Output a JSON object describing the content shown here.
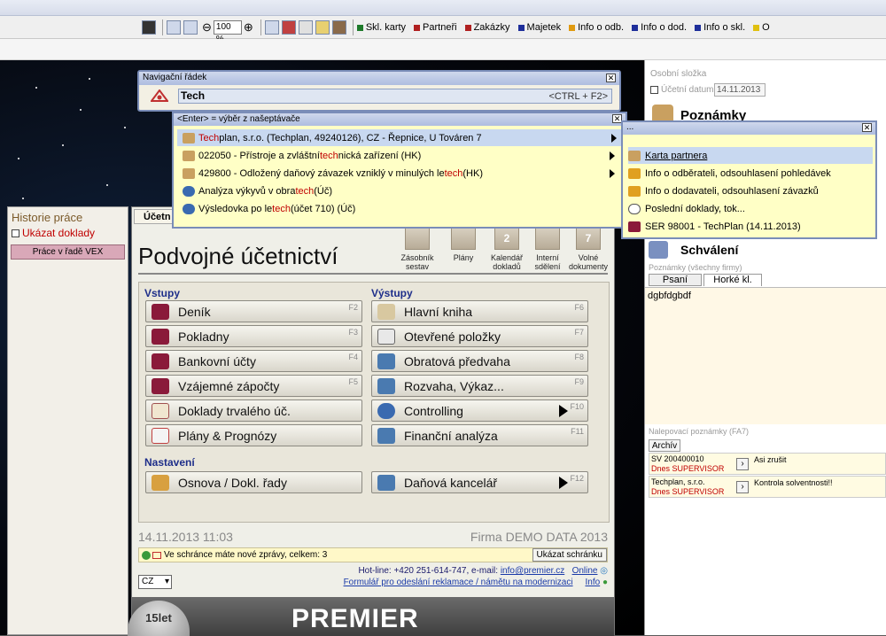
{
  "toolbar": {
    "zoom": "100 %",
    "legend": [
      {
        "label": "Skl. karty",
        "color": "#1e7a2a"
      },
      {
        "label": "Partneři",
        "color": "#b02020"
      },
      {
        "label": "Zakázky",
        "color": "#b02020"
      },
      {
        "label": "Majetek",
        "color": "#1e2e9a"
      },
      {
        "label": "Info o odb.",
        "color": "#e09a10"
      },
      {
        "label": "Info o dod.",
        "color": "#1e2e9a"
      },
      {
        "label": "Info o skl.",
        "color": "#1e2e9a"
      },
      {
        "label": "O",
        "color": "#e0c010"
      }
    ]
  },
  "nav": {
    "title": "Navigační řádek",
    "input_value": "Tech",
    "shortcut_hint": "<CTRL + F2>"
  },
  "suggest": {
    "header": "<Enter> = výběr z našeptávače",
    "rows": [
      {
        "pre": "",
        "hl": "Tech",
        "post": "plan, s.r.o. (Techplan, 49240126), CZ - Řepnice, U Továren 7",
        "arrow": true
      },
      {
        "pre": "022050 - Přístroje a zvláštní ",
        "hl": "tech",
        "post": "nická zařízení (HK)",
        "arrow": true
      },
      {
        "pre": "429800 - Odložený daňový závazek vzniklý v minulých le",
        "hl": "tech",
        "post": " (HK)",
        "arrow": true
      },
      {
        "pre": "Analýza výkyvů v obra",
        "hl": "tech",
        "post": " (Úč)",
        "arrow": false
      },
      {
        "pre": "Výsledovka po le",
        "hl": "tech",
        "post": " (účet 710) (Úč)",
        "arrow": false
      }
    ]
  },
  "ctx": {
    "header": "...",
    "items": [
      "Karta partnera",
      "Info o odběrateli, odsouhlasení pohledávek",
      "Info o dodavateli, odsouhlasení závazků",
      "Poslední doklady, tok...",
      "SER 98001 - TechPlan (14.11.2013)"
    ]
  },
  "history": {
    "title": "Historie práce",
    "show_docs": "Ukázat doklady",
    "button": "Práce v řadě VEX"
  },
  "main": {
    "tab": "Účetn",
    "title": "Podvojné účetnictví",
    "quick": [
      {
        "label": "Zásobník sestav"
      },
      {
        "label": "Plány"
      },
      {
        "label": "Kalendář dokladů",
        "badge": "2"
      },
      {
        "label": "Interní sdělení"
      },
      {
        "label": "Volné dokumenty",
        "badge": "7"
      }
    ],
    "inputs_header": "Vstupy",
    "outputs_header": "Výstupy",
    "settings_header": "Nastavení",
    "inputs": [
      {
        "label": "Deník",
        "key": "F2"
      },
      {
        "label": "Pokladny",
        "key": "F3"
      },
      {
        "label": "Bankovní účty",
        "key": "F4"
      },
      {
        "label": "Vzájemné zápočty",
        "key": "F5"
      },
      {
        "label": "Doklady trvalého úč.",
        "key": ""
      },
      {
        "label": "Plány & Prognózy",
        "key": ""
      }
    ],
    "outputs": [
      {
        "label": "Hlavní kniha",
        "key": "F6"
      },
      {
        "label": "Otevřené položky",
        "key": "F7"
      },
      {
        "label": "Obratová předvaha",
        "key": "F8"
      },
      {
        "label": "Rozvaha, Výkaz...",
        "key": "F9"
      },
      {
        "label": "Controlling",
        "key": "F10"
      },
      {
        "label": "Finanční analýza",
        "key": "F11"
      }
    ],
    "settings_left": {
      "label": "Osnova / Dokl. řady",
      "key": ""
    },
    "settings_right": {
      "label": "Daňová kancelář",
      "key": "F12"
    },
    "date": "14.11.2013  11:03",
    "firm": "Firma DEMO DATA  2013",
    "message": "Ve schránce máte nové zprávy, celkem: 3",
    "show_inbox": "Ukázat schránku",
    "hotline": "Hot-line: +420 251-614-747, e-mail: ",
    "email": "info@premier.cz",
    "online": "Online",
    "form_link": "Formulář pro odeslání reklamace / námětu na modernizaci",
    "info": "Info",
    "lang": "CZ",
    "brand": "PREMIER",
    "anniv": "15let"
  },
  "right": {
    "personal_folder": "Osobní složka",
    "acc_date_label": "Účetní datum:",
    "acc_date": "14.11.2013",
    "notes_title": "Poznámky",
    "approval": "Schválení",
    "notes_sub": "Poznámky   (všechny firmy)",
    "tab_write": "Psaní",
    "tab_hot": "Horké kl.",
    "note_text": "dgbfdgbdf",
    "sticky_header": "Nalepovací poznámky  (FA7)",
    "archive_tab": "Archív",
    "sticky": [
      {
        "doc": "SV 200400010",
        "when": "Dnes SUPERVISOR",
        "text": "Asi zrušit"
      },
      {
        "doc": "Techplan, s.r.o.",
        "when": "Dnes SUPERVISOR",
        "text": "Kontrola solventnosti!!"
      }
    ]
  }
}
